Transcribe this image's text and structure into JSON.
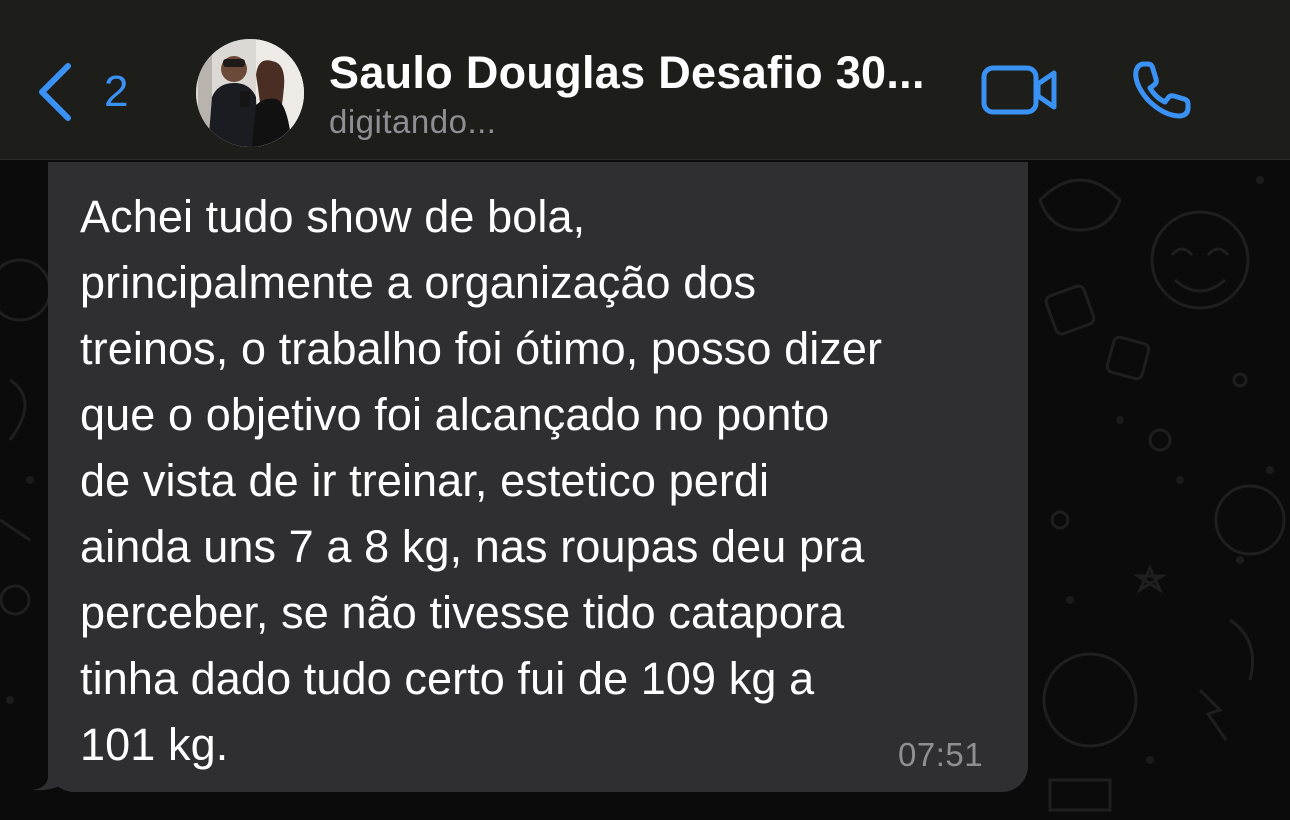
{
  "header": {
    "back_count": "2",
    "contact_name": "Saulo Douglas Desafio 30...",
    "status": "digitando..."
  },
  "icons": {
    "back": "chevron-left-icon",
    "video": "video-camera-icon",
    "call": "phone-icon",
    "avatar": "contact-avatar"
  },
  "colors": {
    "accent": "#3b92f5",
    "bubble": "#2f2f31",
    "header_bg": "#1d1d1a",
    "secondary_text": "#8e8e93"
  },
  "message": {
    "text": "Achei tudo show de bola,\nprincipalmente a organização dos\ntreinos, o trabalho foi ótimo, posso dizer\nque o objetivo foi alcançado no ponto\nde vista de ir treinar, estetico perdi\nainda uns 7 a 8 kg, nas roupas deu pra\nperceber, se não tivesse tido catapora\ntinha dado tudo certo fui de 109 kg a\n101 kg.",
    "time": "07:51"
  }
}
